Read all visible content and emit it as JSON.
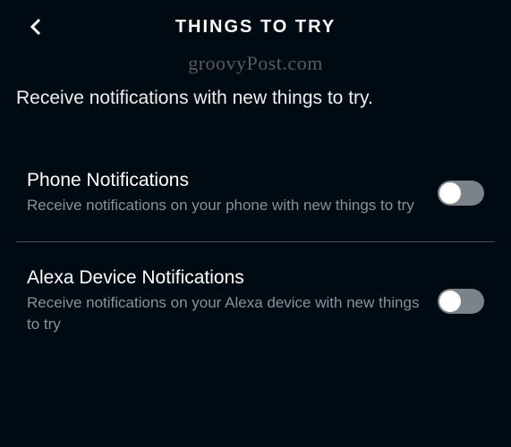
{
  "header": {
    "title": "THINGS TO TRY"
  },
  "watermark": "groovyPost.com",
  "description": "Receive notifications with new things to try.",
  "settings": [
    {
      "title": "Phone Notifications",
      "subtitle": "Receive notifications on your phone with new things to try",
      "enabled": false
    },
    {
      "title": "Alexa Device Notifications",
      "subtitle": "Receive notifications on your Alexa device with new things to try",
      "enabled": false
    }
  ]
}
